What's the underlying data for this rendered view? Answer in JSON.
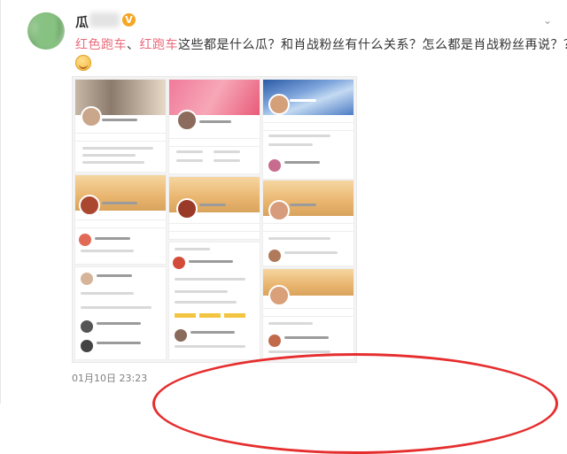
{
  "post": {
    "username": "瓜",
    "verified_badge": "V",
    "text_red_1": "红色跑车",
    "text_sep": "、",
    "text_red_2": "红跑车",
    "text_rest": "这些都是什么瓜？和肖战粉丝有什么关系？怎么都是肖战粉丝再说？？？",
    "emoji_icon": "smile-emoji-icon",
    "timestamp": "01月10日 23:23",
    "more_icon": "chevron-down-icon"
  },
  "colors": {
    "accent_red_text": "#eb6a7c",
    "annotation_red": "#e62e2e",
    "verified_orange": "#f5a623"
  }
}
